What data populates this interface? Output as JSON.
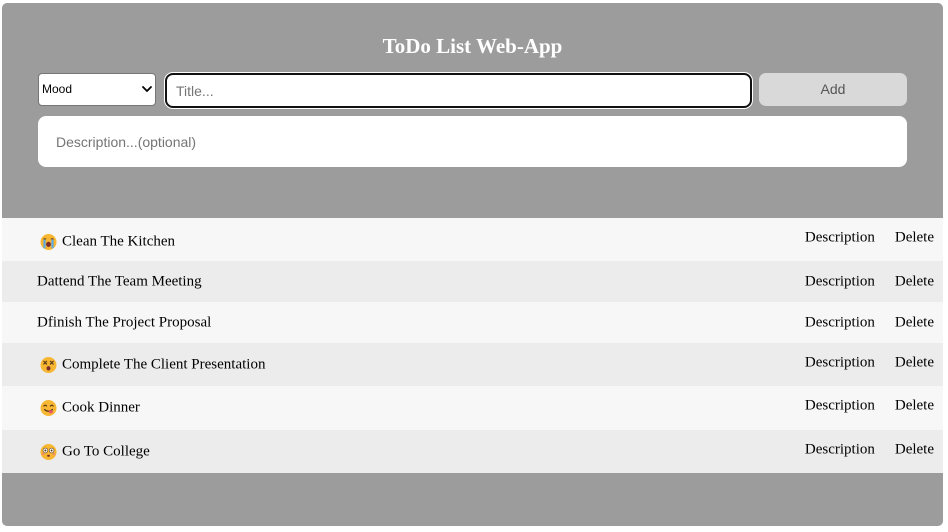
{
  "header": {
    "title": "ToDo List Web-App"
  },
  "form": {
    "mood_select": {
      "selected": "Mood"
    },
    "title_input": {
      "placeholder": "Title..."
    },
    "add_button_label": "Add",
    "description_input": {
      "placeholder": "Description...(optional)"
    }
  },
  "todos": [
    {
      "title": "Clean The Kitchen",
      "mood_icon": "crying-face-icon"
    },
    {
      "title": "Dattend The Team Meeting",
      "mood_icon": ""
    },
    {
      "title": "Dfinish The Project Proposal",
      "mood_icon": ""
    },
    {
      "title": "Complete The Client Presentation",
      "mood_icon": "dizzy-face-icon"
    },
    {
      "title": "Cook Dinner",
      "mood_icon": "yum-face-icon"
    },
    {
      "title": "Go To College",
      "mood_icon": "flushed-face-icon"
    }
  ],
  "row_actions": {
    "description_label": "Description",
    "delete_label": "Delete"
  },
  "colors": {
    "app_background": "#9c9c9c",
    "row_light": "#f7f7f7",
    "row_dark": "#ececec",
    "add_button": "#d9d9d9"
  }
}
